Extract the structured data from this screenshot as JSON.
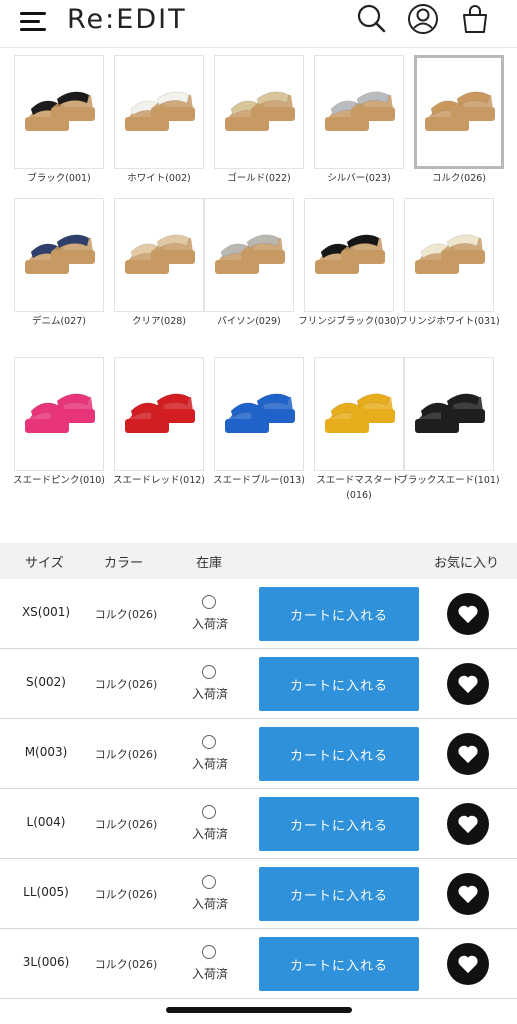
{
  "header": {
    "logo": "Re:EDIT",
    "icons": [
      "menu-icon",
      "search-icon",
      "account-icon",
      "cart-bag-icon"
    ]
  },
  "swatches": [
    {
      "label": "ブラック(001)",
      "shoe": "#1c1c1c",
      "sole": "#c79a64"
    },
    {
      "label": "ホワイト(002)",
      "shoe": "#f3f1ec",
      "sole": "#c79a64"
    },
    {
      "label": "ゴールド(022)",
      "shoe": "#d8c59a",
      "sole": "#c79a64"
    },
    {
      "label": "シルバー(023)",
      "shoe": "#b9bcbf",
      "sole": "#c79a64"
    },
    {
      "label": "コルク(026)",
      "shoe": "#c9985e",
      "sole": "#c79a64",
      "selected": true
    },
    {
      "label": "デニム(027)",
      "shoe": "#2f3f6b",
      "sole": "#c79a64"
    },
    {
      "label": "クリア(028)",
      "shoe": "#e2c9a5",
      "sole": "#c79a64"
    },
    {
      "label": "パイソン(029)",
      "shoe": "#b8b8b0",
      "sole": "#c79a64"
    },
    {
      "label": "フリンジブラック(030)",
      "shoe": "#161616",
      "sole": "#c79a64"
    },
    {
      "label": "フリンジホワイト(031)",
      "shoe": "#efe6cf",
      "sole": "#c79a64"
    },
    {
      "label": "スエードピンク(010)",
      "shoe": "#e8347a",
      "sole": "#e8347a"
    },
    {
      "label": "スエードレッド(012)",
      "shoe": "#d21e22",
      "sole": "#d21e22"
    },
    {
      "label": "スエードブルー(013)",
      "shoe": "#2063c8",
      "sole": "#2063c8"
    },
    {
      "label": "スエードマスタード(016)",
      "shoe": "#e8ad1c",
      "sole": "#e8ad1c"
    },
    {
      "label": "ブラックスエード(101)",
      "shoe": "#1e1e1e",
      "sole": "#1e1e1e"
    }
  ],
  "table": {
    "headers": {
      "size": "サイズ",
      "color": "カラー",
      "stock": "在庫",
      "favorite": "お気に入り"
    },
    "rows": [
      {
        "size": "XS(001)",
        "color": "コルク(026)",
        "stock": "入荷済",
        "cart": "カートに入れる"
      },
      {
        "size": "S(002)",
        "color": "コルク(026)",
        "stock": "入荷済",
        "cart": "カートに入れる"
      },
      {
        "size": "M(003)",
        "color": "コルク(026)",
        "stock": "入荷済",
        "cart": "カートに入れる"
      },
      {
        "size": "L(004)",
        "color": "コルク(026)",
        "stock": "入荷済",
        "cart": "カートに入れる"
      },
      {
        "size": "LL(005)",
        "color": "コルク(026)",
        "stock": "入荷済",
        "cart": "カートに入れる"
      },
      {
        "size": "3L(006)",
        "color": "コルク(026)",
        "stock": "入荷済",
        "cart": "カートに入れる"
      }
    ]
  },
  "colors": {
    "accent": "#2f91d9",
    "header_bg": "#f2f2f2",
    "fav_bg": "#111111"
  }
}
